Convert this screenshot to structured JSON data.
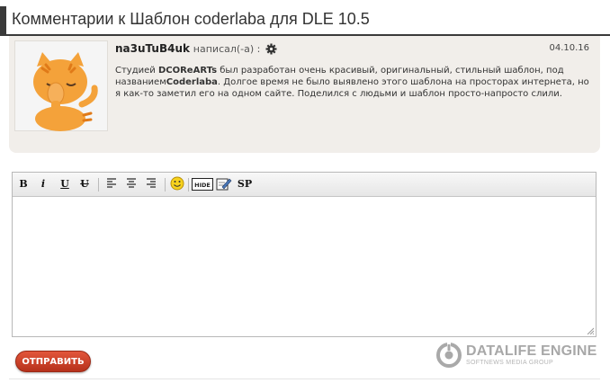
{
  "header": {
    "title": "Комментарии к Шаблон coderlaba для DLE 10.5"
  },
  "comment": {
    "author": "na3uTuB4uk",
    "wrote": "написал(-а) :",
    "date": "04.10.16",
    "text_parts": {
      "p1": "Студией ",
      "b1": "DCOReARTs",
      "p2": " был разработан очень красивый, оригинальный, стильный шаблон, под названием",
      "b2": "Coderlaba",
      "p3": ". Долгое время не было выявлено этого шаблона на просторах интернета, но я как-то заметил его на одном сайте. Поделился с людьми и шаблон просто-напросто слили."
    },
    "avatar_icon": "cat-facepalm-icon"
  },
  "toolbar": {
    "bold": "B",
    "italic": "i",
    "underline": "U",
    "strike": "U",
    "hide": "HIDE",
    "spoiler": "SP",
    "icons": [
      "align-left-icon",
      "align-center-icon",
      "align-right-icon",
      "smiley-icon",
      "hide-icon",
      "edit-link-icon"
    ]
  },
  "editor": {
    "value": ""
  },
  "form": {
    "submit_label": "ОТПРАВИТЬ"
  },
  "footer": {
    "brand": "DATALIFE ENGINE",
    "sub": "SOFTNEWS MEDIA GROUP"
  },
  "colors": {
    "header_accent": "#3a3a3a",
    "comment_bg": "#f1eeea",
    "submit": "#c9402a",
    "brand_gray": "#a8a8a8",
    "cat_orange": "#f4a23a"
  }
}
